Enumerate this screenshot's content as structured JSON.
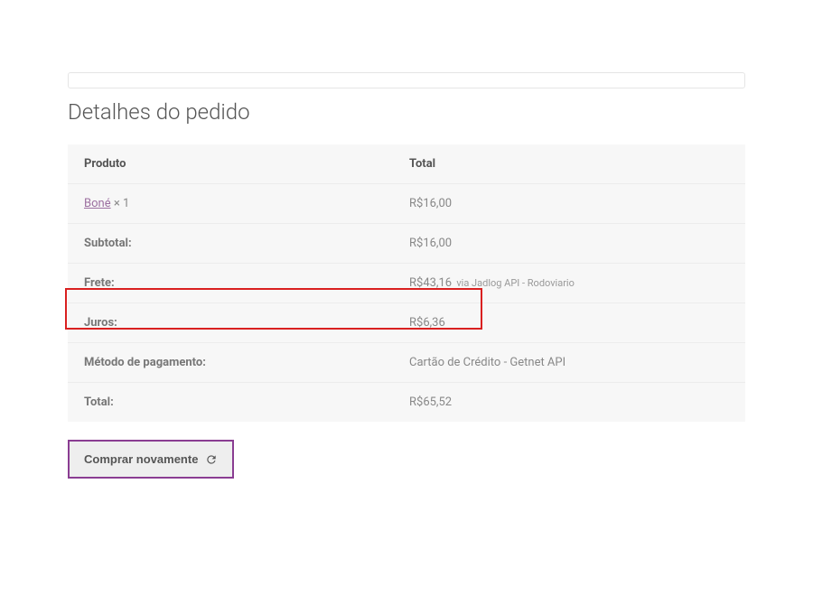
{
  "section_title": "Detalhes do pedido",
  "table": {
    "headers": {
      "product": "Produto",
      "total": "Total"
    },
    "product_row": {
      "name": "Boné",
      "qty": "× 1",
      "price": "R$16,00"
    },
    "rows": {
      "subtotal": {
        "label": "Subtotal:",
        "value": "R$16,00"
      },
      "frete": {
        "label": "Frete:",
        "value": "R$43,16",
        "note": "via Jadlog API - Rodoviario"
      },
      "juros": {
        "label": "Juros:",
        "value": "R$6,36"
      },
      "metodo": {
        "label": "Método de pagamento:",
        "value": "Cartão de Crédito - Getnet API"
      },
      "total": {
        "label": "Total:",
        "value": "R$65,52"
      }
    }
  },
  "button": {
    "reorder": "Comprar novamente"
  }
}
